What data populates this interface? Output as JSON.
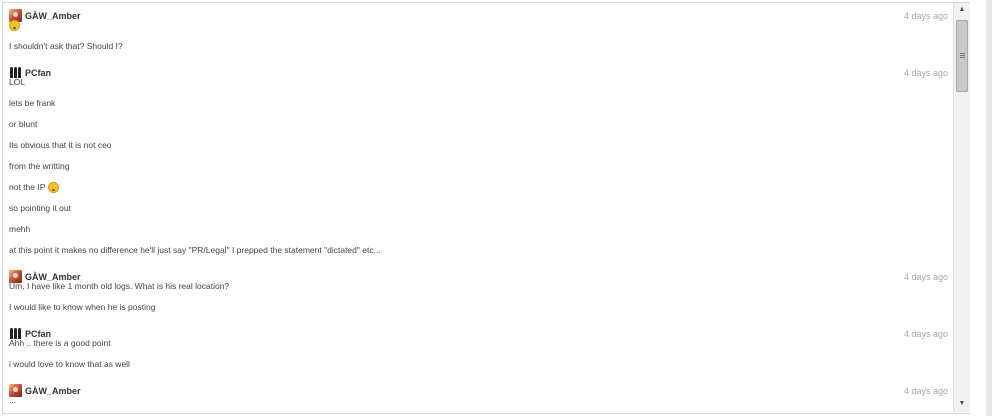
{
  "chat": {
    "posts": [
      {
        "user": "GÀW_Amber",
        "avatar": "amber-avatar",
        "time": "4 days ago",
        "messages": [
          {
            "text": "",
            "emoji": "worried-face-emoji"
          },
          {
            "text": "I shouldn't ask that? Should I?"
          }
        ]
      },
      {
        "user": "PCfan",
        "avatar": "pcfan-avatar",
        "time": "4 days ago",
        "messages": [
          {
            "text": "LOL"
          },
          {
            "text": "lets be frank"
          },
          {
            "text": "or blunt"
          },
          {
            "text": "Its obvious that it is not ceo"
          },
          {
            "text": "from the writting"
          },
          {
            "text": "not the IP",
            "emoji": "grinning-face-emoji"
          },
          {
            "text": "so pointing it out"
          },
          {
            "text": "mehh"
          },
          {
            "text": "at this point it makes no difference he'll just say \"PR/Legal\" I prepped the statement \"dictated\" etc..."
          }
        ]
      },
      {
        "user": "GÀW_Amber",
        "avatar": "amber-avatar",
        "time": "4 days ago",
        "messages": [
          {
            "text": "Um, I have like 1 month old logs. What is his real location?"
          },
          {
            "text": "I would like to know when he is posting"
          }
        ]
      },
      {
        "user": "PCfan",
        "avatar": "pcfan-avatar",
        "time": "4 days ago",
        "messages": [
          {
            "text": "Ahh .. there is a good point"
          },
          {
            "text": "i would love to know that as well"
          }
        ]
      },
      {
        "user": "GÀW_Amber",
        "avatar": "amber-avatar",
        "time": "4 days ago",
        "messages": [
          {
            "text": "..."
          }
        ]
      }
    ]
  },
  "scrollbar": {
    "up_icon": "arrow-up-icon",
    "down_icon": "arrow-down-icon",
    "position_fraction": 0.04
  }
}
